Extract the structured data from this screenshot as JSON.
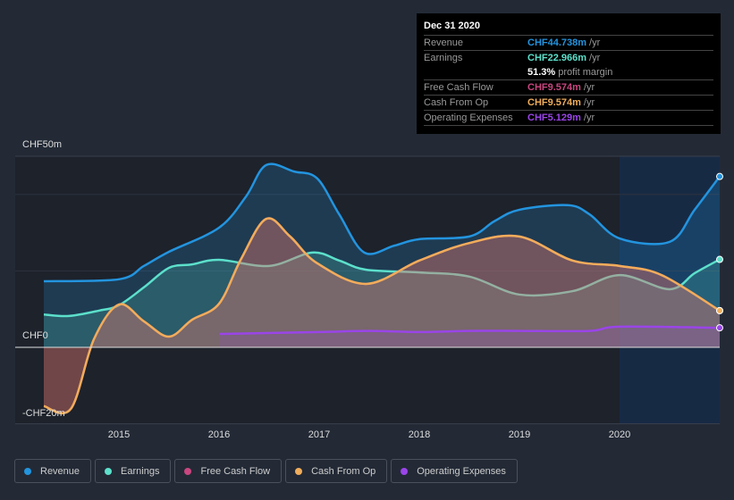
{
  "tooltip": {
    "date": "Dec 31 2020",
    "rows": [
      {
        "label": "Revenue",
        "value": "CHF44.738m",
        "unit": "/yr",
        "color": "#2394df"
      },
      {
        "label": "Earnings",
        "value": "CHF22.966m",
        "unit": "/yr",
        "color": "#5ce0cb"
      },
      {
        "label": "",
        "value": "51.3%",
        "unit": "profit margin",
        "color": "#ffffff"
      },
      {
        "label": "Free Cash Flow",
        "value": "CHF9.574m",
        "unit": "/yr",
        "color": "#c9467f"
      },
      {
        "label": "Cash From Op",
        "value": "CHF9.574m",
        "unit": "/yr",
        "color": "#f0ad5a"
      },
      {
        "label": "Operating Expenses",
        "value": "CHF5.129m",
        "unit": "/yr",
        "color": "#9a45e8"
      }
    ]
  },
  "chart_data": {
    "type": "area",
    "ylim": [
      -20,
      50
    ],
    "xlim": [
      2014.25,
      2021
    ],
    "y_tick_labels": [
      {
        "v": 50,
        "label": "CHF50m"
      },
      {
        "v": 0,
        "label": "CHF0"
      },
      {
        "v": -20,
        "label": "-CHF20m"
      }
    ],
    "x_tick_labels": [
      "2015",
      "2016",
      "2017",
      "2018",
      "2019",
      "2020"
    ],
    "x_ticks": [
      2015,
      2016,
      2017,
      2018,
      2019,
      2020
    ],
    "forecast_start": 2020,
    "legend_position": "bottom-left",
    "series": [
      {
        "name": "Revenue",
        "color": "#2394df",
        "x": [
          2014.25,
          2015,
          2015.25,
          2015.5,
          2016,
          2016.27,
          2016.47,
          2016.75,
          2016.98,
          2017.2,
          2017.45,
          2017.75,
          2018,
          2018.5,
          2018.75,
          2019,
          2019.48,
          2019.7,
          2020,
          2020.5,
          2020.75,
          2021
        ],
        "y": [
          17.3,
          17.8,
          21.3,
          25,
          31.3,
          39.5,
          47.7,
          46,
          44.2,
          34.8,
          24.8,
          26.6,
          28.3,
          29,
          33,
          36,
          37.2,
          34.8,
          28.5,
          27.6,
          36,
          44.7
        ]
      },
      {
        "name": "Earnings",
        "color": "#5ce0cb",
        "x": [
          2014.25,
          2014.5,
          2014.8,
          2015,
          2015.25,
          2015.5,
          2015.73,
          2016,
          2016.5,
          2016.93,
          2017.2,
          2017.47,
          2018,
          2018.5,
          2019,
          2019.53,
          2020,
          2020.5,
          2020.75,
          2021
        ],
        "y": [
          8.6,
          8.2,
          9.6,
          11,
          15.7,
          20.8,
          21.7,
          22.9,
          21.3,
          24.8,
          22.7,
          20.3,
          19.6,
          18.5,
          13.8,
          14.7,
          18.9,
          15.2,
          19.4,
          23
        ]
      },
      {
        "name": "Free Cash Flow",
        "color": "#c9467f",
        "x": [
          2014.25,
          2014.52,
          2014.75,
          2015,
          2015.25,
          2015.5,
          2015.73,
          2016,
          2016.22,
          2016.47,
          2016.71,
          2016.98,
          2017.47,
          2018,
          2018.5,
          2019,
          2019.53,
          2020,
          2020.42,
          2021
        ],
        "y": [
          -15.4,
          -16.1,
          2.1,
          11.2,
          6.8,
          2.8,
          7.2,
          11.4,
          23.1,
          33.6,
          29,
          22,
          16.6,
          22.7,
          27.3,
          29,
          22.7,
          21.3,
          18.9,
          9.6
        ]
      },
      {
        "name": "Cash From Op",
        "color": "#f0ad5a",
        "x": [
          2014.25,
          2014.52,
          2014.75,
          2015,
          2015.25,
          2015.5,
          2015.73,
          2016,
          2016.22,
          2016.47,
          2016.71,
          2016.98,
          2017.47,
          2018,
          2018.5,
          2019,
          2019.53,
          2020,
          2020.42,
          2021
        ],
        "y": [
          -15.4,
          -16.1,
          2.1,
          11.2,
          6.8,
          2.8,
          7.2,
          11.4,
          23.1,
          33.6,
          29,
          22,
          16.6,
          22.7,
          27.3,
          29,
          22.7,
          21.3,
          18.9,
          9.6
        ]
      },
      {
        "name": "Operating Expenses",
        "color": "#9a45e8",
        "x": [
          2016,
          2017,
          2017.5,
          2018,
          2018.5,
          2019,
          2019.7,
          2020,
          2021
        ],
        "y": [
          3.5,
          4,
          4.3,
          4,
          4.3,
          4.3,
          4.3,
          5.4,
          5.1
        ]
      }
    ]
  }
}
